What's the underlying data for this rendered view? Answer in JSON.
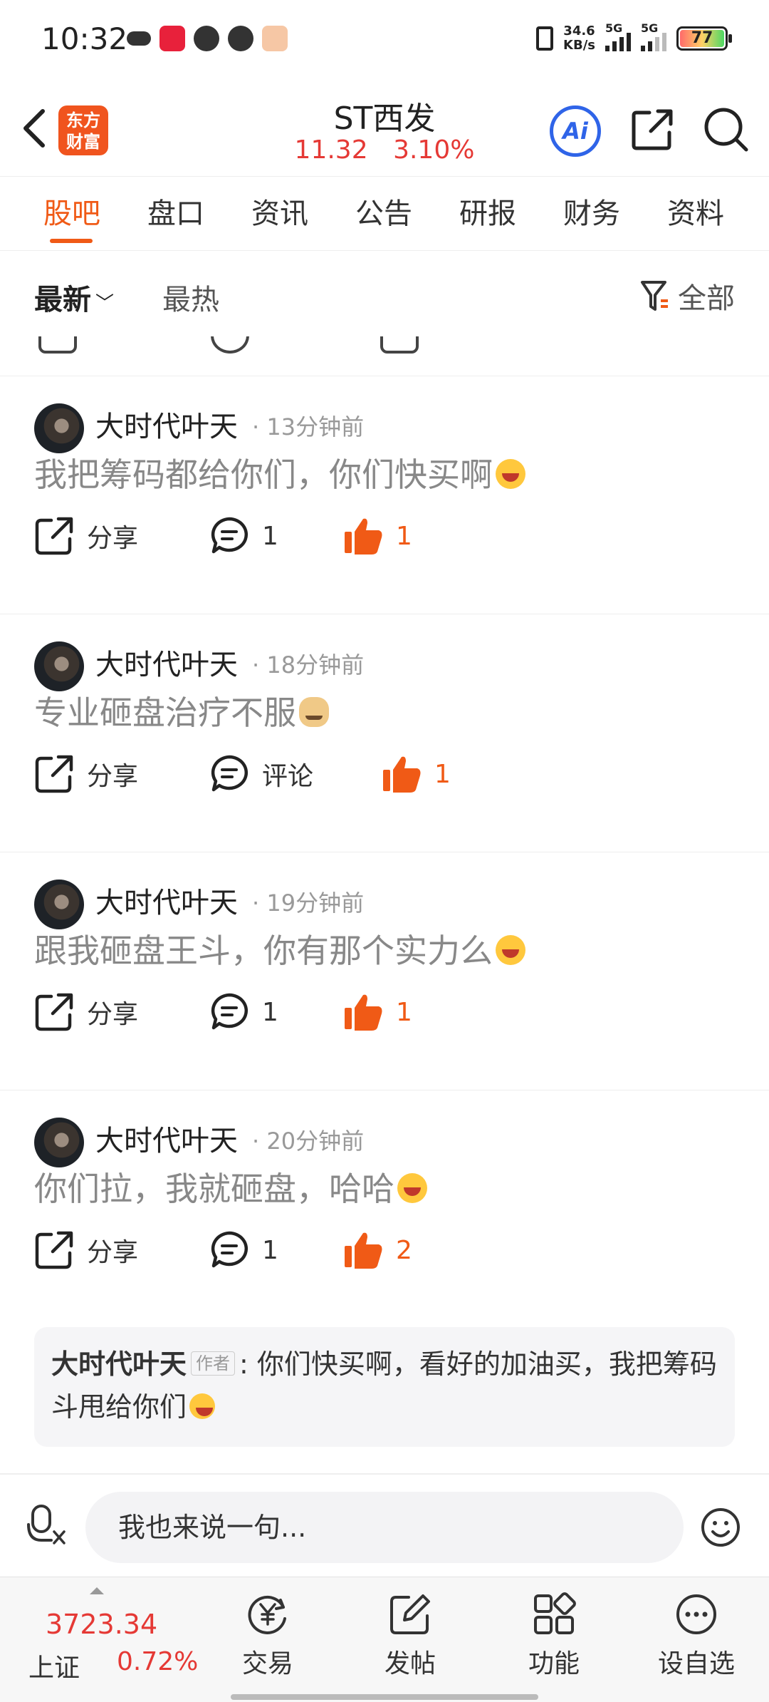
{
  "status_bar": {
    "time": "10:32",
    "net_speed_value": "34.6",
    "net_speed_unit": "KB/s",
    "signal1_label": "5G",
    "signal2_label": "5G",
    "battery": "77"
  },
  "header": {
    "title": "ST西发",
    "price": "11.32",
    "change": "3.10%",
    "ai_label": "Ai",
    "logo_line1": "东方",
    "logo_line2": "财富"
  },
  "tabs": [
    "股吧",
    "盘口",
    "资讯",
    "公告",
    "研报",
    "财务",
    "资料"
  ],
  "sort": {
    "newest": "最新",
    "hottest": "最热",
    "filter_label": "全部"
  },
  "posts": [
    {
      "user": "大时代叶天",
      "time": "· 13分钟前",
      "text": "我把筹码都给你们，你们快买啊",
      "share": "分享",
      "comments": "1",
      "likes": "1"
    },
    {
      "user": "大时代叶天",
      "time": "· 18分钟前",
      "text": "专业砸盘治疗不服",
      "share": "分享",
      "comments": "评论",
      "likes": "1"
    },
    {
      "user": "大时代叶天",
      "time": "· 19分钟前",
      "text": "跟我砸盘王斗，你有那个实力么",
      "share": "分享",
      "comments": "1",
      "likes": "1"
    },
    {
      "user": "大时代叶天",
      "time": "· 20分钟前",
      "text": "你们拉，我就砸盘，哈哈",
      "share": "分享",
      "comments": "1",
      "likes": "2"
    }
  ],
  "reply": {
    "user": "大时代叶天",
    "badge": "作者",
    "text": ": 你们快买啊，看好的加油买，我把筹码斗甩给你们"
  },
  "input": {
    "placeholder": "我也来说一句..."
  },
  "bottom_nav": {
    "index_value": "3723.34",
    "index_name": "上证",
    "index_change": "0.72%",
    "items": [
      "交易",
      "发帖",
      "功能",
      "设自选"
    ]
  },
  "colors": {
    "accent": "#f05a16",
    "up_red": "#e53935",
    "ai_blue": "#2f64e8"
  }
}
